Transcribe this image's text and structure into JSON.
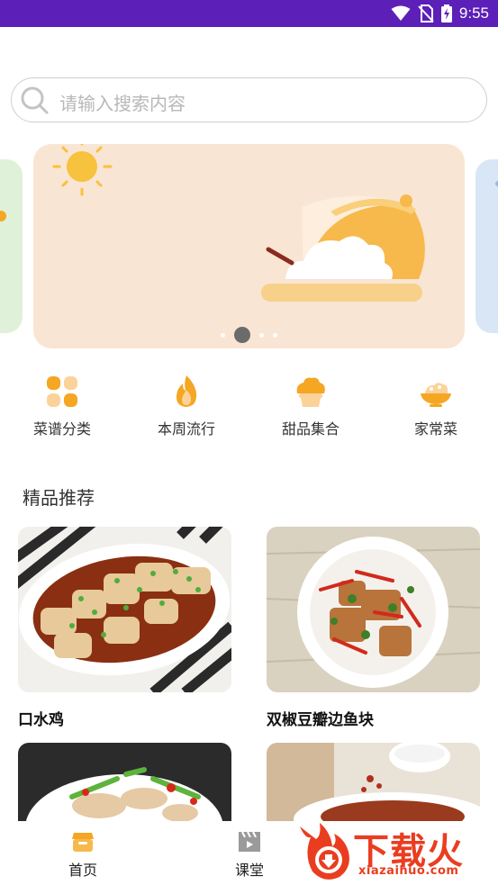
{
  "status_bar": {
    "time": "9:55"
  },
  "search": {
    "placeholder": "请输入搜索内容"
  },
  "banner": {
    "page_count": 4,
    "active_index": 1
  },
  "categories": [
    {
      "label": "菜谱分类",
      "icon": "grid-icon"
    },
    {
      "label": "本周流行",
      "icon": "fire-icon"
    },
    {
      "label": "甜品集合",
      "icon": "cupcake-icon"
    },
    {
      "label": "家常菜",
      "icon": "dish-bowl-icon"
    }
  ],
  "section": {
    "title": "精品推荐"
  },
  "recipes": [
    {
      "name": "口水鸡"
    },
    {
      "name": "双椒豆瓣边鱼块"
    },
    {
      "name": ""
    },
    {
      "name": ""
    }
  ],
  "tabbar": {
    "items": [
      {
        "label": "首页",
        "icon": "home-store-icon"
      },
      {
        "label": "课堂",
        "icon": "video-clapper-icon"
      }
    ]
  },
  "watermark": {
    "text": "下载火",
    "url": "xiazaihuo.com"
  },
  "colors": {
    "status_bar": "#5c1fb8",
    "accent": "#f5a623",
    "banner_bg": "#f9e5d3",
    "watermark": "#ea3d20"
  }
}
